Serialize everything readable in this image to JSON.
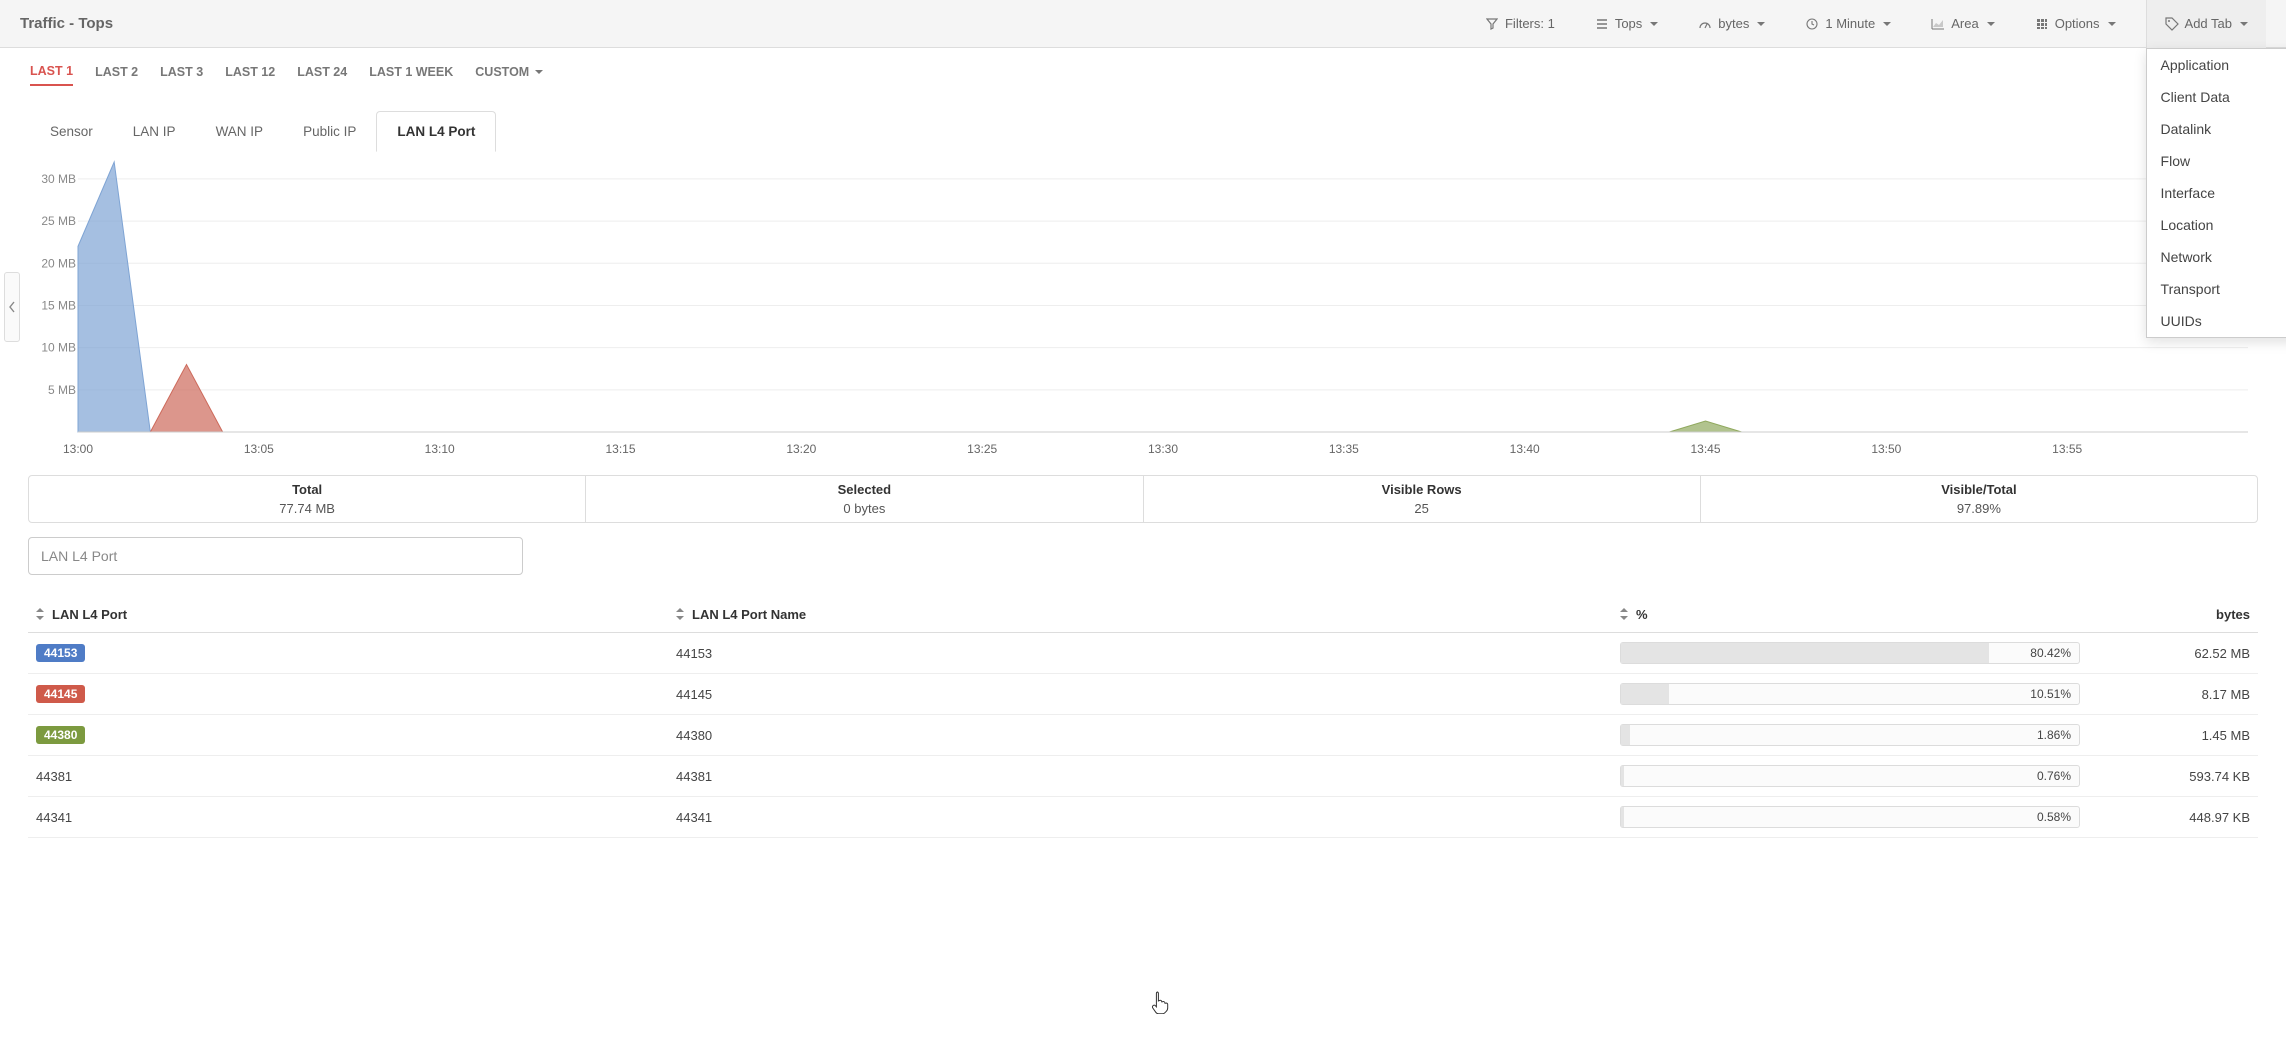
{
  "header": {
    "title": "Traffic - Tops",
    "controls": {
      "filters": "Filters: 1",
      "tops": "Tops",
      "bytes": "bytes",
      "interval": "1 Minute",
      "area": "Area",
      "options": "Options",
      "add_tab": "Add Tab"
    }
  },
  "addtab_menu": [
    "Application",
    "Client Data",
    "Datalink",
    "Flow",
    "Interface",
    "Location",
    "Network",
    "Transport",
    "UUIDs"
  ],
  "range_tabs": {
    "items": [
      "LAST 1",
      "LAST 2",
      "LAST 3",
      "LAST 12",
      "LAST 24",
      "LAST 1 WEEK"
    ],
    "custom": "CUSTOM",
    "active": 0
  },
  "sub_tabs": {
    "items": [
      "Sensor",
      "LAN IP",
      "WAN IP",
      "Public IP",
      "LAN L4 Port"
    ],
    "active": 4
  },
  "chart_data": {
    "type": "area",
    "xlabel": "",
    "ylabel": "",
    "ylim": [
      0,
      32
    ],
    "yticks": [
      "5 MB",
      "10 MB",
      "15 MB",
      "20 MB",
      "25 MB",
      "30 MB"
    ],
    "x_ticks": [
      "13:00",
      "13:05",
      "13:10",
      "13:15",
      "13:20",
      "13:25",
      "13:30",
      "13:35",
      "13:40",
      "13:45",
      "13:50",
      "13:55"
    ],
    "series": [
      {
        "name": "44153",
        "color": "#7fa4d4",
        "points": [
          {
            "x": "13:00",
            "y": 22
          },
          {
            "x": "13:01",
            "y": 32
          },
          {
            "x": "13:02",
            "y": 0
          }
        ]
      },
      {
        "name": "44145",
        "color": "#cd6a5b",
        "points": [
          {
            "x": "13:02",
            "y": 0
          },
          {
            "x": "13:03",
            "y": 8
          },
          {
            "x": "13:04",
            "y": 0
          }
        ]
      },
      {
        "name": "44380",
        "color": "#90a95e",
        "points": [
          {
            "x": "13:44",
            "y": 0
          },
          {
            "x": "13:45",
            "y": 1.3
          },
          {
            "x": "13:46",
            "y": 0
          }
        ]
      }
    ]
  },
  "summary": {
    "total": {
      "label": "Total",
      "value": "77.74 MB"
    },
    "selected": {
      "label": "Selected",
      "value": "0 bytes"
    },
    "visible_rows": {
      "label": "Visible Rows",
      "value": "25"
    },
    "visible_total": {
      "label": "Visible/Total",
      "value": "97.89%"
    }
  },
  "filter": {
    "placeholder": "LAN L4 Port"
  },
  "table": {
    "columns": {
      "port": "LAN L4 Port",
      "name": "LAN L4 Port Name",
      "pct": "%",
      "bytes": "bytes"
    },
    "rows": [
      {
        "port": "44153",
        "badge_color": "#4f7cc6",
        "name": "44153",
        "pct": 80.42,
        "pct_text": "80.42%",
        "bytes": "62.52 MB"
      },
      {
        "port": "44145",
        "badge_color": "#cf5a4a",
        "name": "44145",
        "pct": 10.51,
        "pct_text": "10.51%",
        "bytes": "8.17 MB"
      },
      {
        "port": "44380",
        "badge_color": "#7c9a3f",
        "name": "44380",
        "pct": 1.86,
        "pct_text": "1.86%",
        "bytes": "1.45 MB"
      },
      {
        "port": "44381",
        "badge_color": "",
        "name": "44381",
        "pct": 0.76,
        "pct_text": "0.76%",
        "bytes": "593.74 KB"
      },
      {
        "port": "44341",
        "badge_color": "",
        "name": "44341",
        "pct": 0.58,
        "pct_text": "0.58%",
        "bytes": "448.97 KB"
      }
    ]
  }
}
